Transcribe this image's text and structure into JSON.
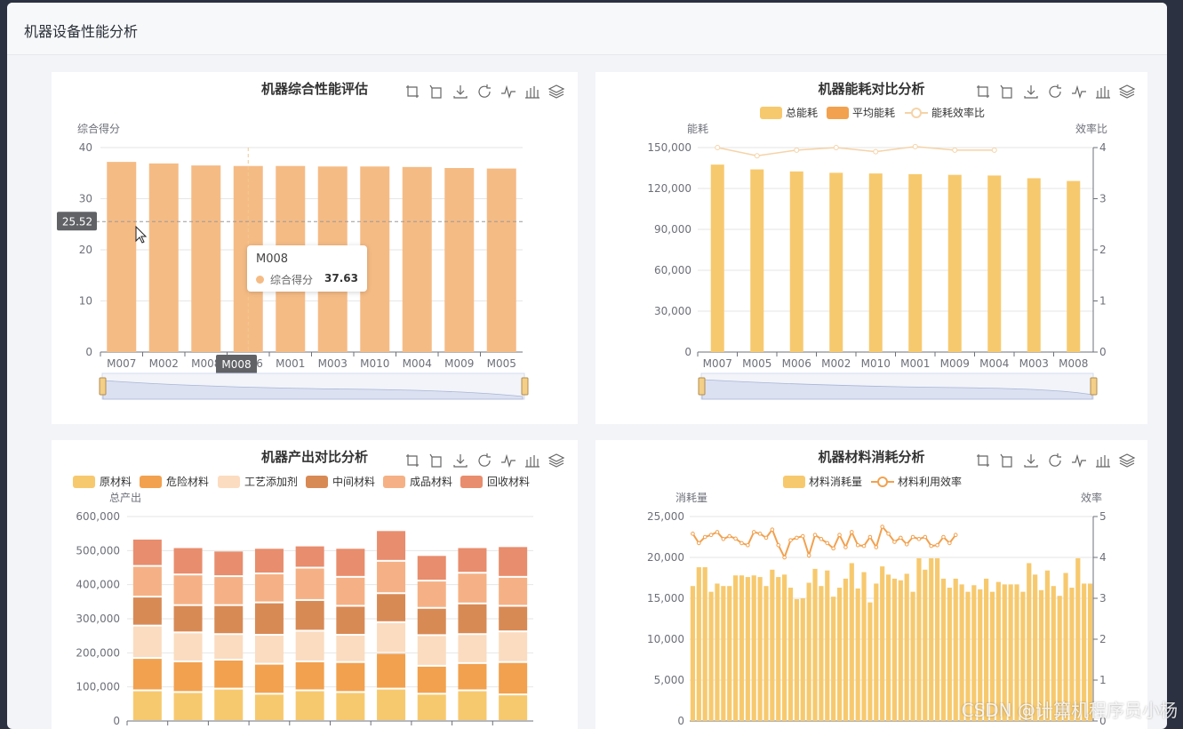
{
  "page": {
    "title": "机器设备性能分析",
    "watermark": "CSDN @计算机程序员小杨"
  },
  "toolbox_icons": [
    "zoom-select-icon",
    "zoom-reset-icon",
    "download-icon",
    "restore-icon",
    "line-chart-icon",
    "bar-chart-icon",
    "stack-icon"
  ],
  "colors": {
    "orange_bar": "#f5bb85",
    "yellow_bar": "#f7c96e",
    "accent": "#f2a14f"
  },
  "chart_data": [
    {
      "id": "score",
      "type": "bar",
      "title": "机器综合性能评估",
      "ylabel": "综合得分",
      "ylim": [
        0,
        40
      ],
      "yticks": [
        "0",
        "10",
        "20",
        "30",
        "40"
      ],
      "categories": [
        "M007",
        "M002",
        "M008",
        "M006",
        "M001",
        "M003",
        "M010",
        "M004",
        "M009",
        "M005"
      ],
      "series": [
        {
          "name": "综合得分",
          "values": [
            37.2,
            36.9,
            36.5,
            36.4,
            36.4,
            36.3,
            36.3,
            36.2,
            36.0,
            35.9
          ]
        }
      ],
      "pointer": {
        "value_label": "25.52",
        "value": 25.52,
        "category_label": "M008"
      },
      "tooltip": {
        "title": "M008",
        "series": "综合得分",
        "value": "37.63"
      },
      "has_datazoom": true
    },
    {
      "id": "energy",
      "type": "bar",
      "title": "机器能耗对比分析",
      "legend": [
        "总能耗",
        "平均能耗",
        "能耗效率比"
      ],
      "ylabel": "能耗",
      "y2label": "效率比",
      "ylim": [
        0,
        150000
      ],
      "y2lim": [
        0,
        4
      ],
      "yticks": [
        "0",
        "30,000",
        "60,000",
        "90,000",
        "120,000",
        "150,000"
      ],
      "y2ticks": [
        "0",
        "1",
        "2",
        "3",
        "4"
      ],
      "categories": [
        "M007",
        "M005",
        "M006",
        "M002",
        "M010",
        "M001",
        "M009",
        "M004",
        "M003",
        "M008"
      ],
      "series": [
        {
          "name": "总能耗",
          "values": [
            137500,
            134000,
            132500,
            131500,
            131000,
            130500,
            130000,
            129500,
            127500,
            125500
          ]
        },
        {
          "name": "能耗效率比",
          "values": [
            4.0,
            3.84,
            3.95,
            4.0,
            3.92,
            4.02,
            3.95,
            3.95
          ]
        }
      ],
      "has_datazoom": true
    },
    {
      "id": "output",
      "type": "bar",
      "title": "机器产出对比分析",
      "legend": [
        "原材料",
        "危险材料",
        "工艺添加剂",
        "中间材料",
        "成品材料",
        "回收材料"
      ],
      "ylabel": "总产出",
      "ylim": [
        0,
        600000
      ],
      "yticks": [
        "0",
        "100,000",
        "200,000",
        "300,000",
        "400,000",
        "500,000",
        "600,000"
      ],
      "series": [
        {
          "name": "原材料",
          "values": [
            90000,
            85000,
            95000,
            80000,
            90000,
            85000,
            95000,
            80000,
            90000,
            78000
          ]
        },
        {
          "name": "危险材料",
          "values": [
            95000,
            90000,
            85000,
            88000,
            85000,
            88000,
            105000,
            82000,
            80000,
            95000
          ]
        },
        {
          "name": "工艺添加剂",
          "values": [
            95000,
            85000,
            75000,
            85000,
            90000,
            80000,
            90000,
            90000,
            85000,
            90000
          ]
        },
        {
          "name": "中间材料",
          "values": [
            85000,
            80000,
            85000,
            95000,
            90000,
            85000,
            85000,
            80000,
            90000,
            75000
          ]
        },
        {
          "name": "成品材料",
          "values": [
            90000,
            90000,
            85000,
            85000,
            95000,
            85000,
            95000,
            80000,
            90000,
            85000
          ]
        },
        {
          "name": "回收材料",
          "values": [
            80000,
            80000,
            75000,
            75000,
            65000,
            85000,
            90000,
            75000,
            75000,
            90000
          ]
        }
      ]
    },
    {
      "id": "material",
      "type": "bar",
      "title": "机器材料消耗分析",
      "legend": [
        "材料消耗量",
        "材料利用效率"
      ],
      "ylabel": "消耗量",
      "y2label": "效率",
      "ylim": [
        0,
        25000
      ],
      "y2lim": [
        0,
        5
      ],
      "yticks": [
        "0",
        "5,000",
        "10,000",
        "15,000",
        "20,000",
        "25,000"
      ],
      "y2ticks": [
        "0",
        "1",
        "2",
        "3",
        "4",
        "5"
      ],
      "series": [
        {
          "name": "材料消耗量",
          "values": [
            16500,
            18800,
            18800,
            15800,
            16800,
            16500,
            16500,
            17800,
            17800,
            17600,
            17800,
            17600,
            16500,
            18500,
            17600,
            17900,
            16300,
            14900,
            15000,
            16900,
            18600,
            16500,
            18400,
            15200,
            16300,
            17400,
            19300,
            16200,
            18200,
            14500,
            16800,
            18900,
            17900,
            17400,
            17200,
            18000,
            15800,
            19900,
            18500,
            19900,
            19900,
            17400,
            16300,
            17400,
            16700,
            15800,
            16600,
            16100,
            17400,
            15800,
            17000,
            16700,
            16700,
            16700,
            15800,
            19300,
            17900,
            16000,
            18400,
            16500,
            15300,
            18100,
            16300,
            19900,
            16800,
            16800
          ]
        },
        {
          "name": "材料利用效率",
          "values": [
            4.58,
            4.35,
            4.5,
            4.55,
            4.62,
            4.45,
            4.52,
            4.46,
            4.35,
            4.3,
            4.62,
            4.58,
            4.48,
            4.68,
            4.3,
            4.0,
            4.42,
            4.48,
            4.52,
            4.05,
            4.55,
            4.45,
            4.35,
            4.22,
            4.55,
            4.25,
            4.62,
            4.3,
            4.28,
            4.5,
            4.25,
            4.75,
            4.58,
            4.38,
            4.48,
            4.32,
            4.5,
            4.45,
            4.5,
            4.28,
            4.3,
            4.5,
            4.35,
            4.55
          ]
        }
      ]
    }
  ]
}
